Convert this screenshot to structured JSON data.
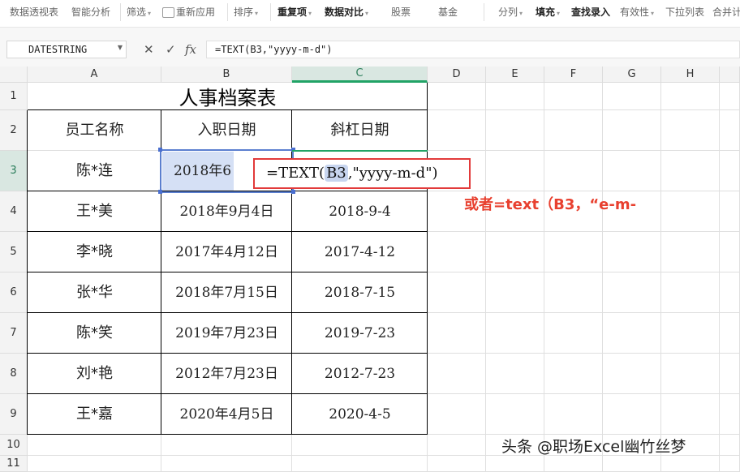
{
  "toolbar": {
    "items": [
      {
        "label": "数据透视表",
        "bold": false,
        "caret": false
      },
      {
        "label": "智能分析",
        "bold": false,
        "caret": false
      },
      {
        "label": "筛选",
        "bold": false,
        "caret": true
      },
      {
        "label": "重新应用",
        "bold": false,
        "caret": false
      },
      {
        "label": "排序",
        "bold": false,
        "caret": true
      },
      {
        "label": "重复项",
        "bold": true,
        "caret": true
      },
      {
        "label": "数据对比",
        "bold": true,
        "caret": true
      },
      {
        "label": "股票",
        "bold": false,
        "caret": false
      },
      {
        "label": "基金",
        "bold": false,
        "caret": false
      },
      {
        "label": "分列",
        "bold": false,
        "caret": true
      },
      {
        "label": "填充",
        "bold": true,
        "caret": true
      },
      {
        "label": "查找录入",
        "bold": true,
        "caret": false
      },
      {
        "label": "有效性",
        "bold": false,
        "caret": true
      },
      {
        "label": "下拉列表",
        "bold": false,
        "caret": false
      },
      {
        "label": "合并计",
        "bold": false,
        "caret": false
      }
    ]
  },
  "formula_bar": {
    "name_box": "DATESTRING",
    "cancel_icon": "✕",
    "confirm_icon": "✓",
    "fx_icon": "fx",
    "formula": "=TEXT(B3,\"yyyy-m-d\")"
  },
  "columns": [
    "A",
    "B",
    "C",
    "D",
    "E",
    "F",
    "G",
    "H"
  ],
  "rows": [
    "1",
    "2",
    "3",
    "4",
    "5",
    "6",
    "7",
    "8",
    "9",
    "10",
    "11"
  ],
  "sheet": {
    "title": "人事档案表",
    "headers": [
      "员工名称",
      "入职日期",
      "斜杠日期"
    ],
    "data": [
      {
        "name": "陈*连",
        "date": "2018年6",
        "slash": ""
      },
      {
        "name": "王*美",
        "date": "2018年9月4日",
        "slash": "2018-9-4"
      },
      {
        "name": "李*晓",
        "date": "2017年4月12日",
        "slash": "2017-4-12"
      },
      {
        "name": "张*华",
        "date": "2018年7月15日",
        "slash": "2018-7-15"
      },
      {
        "name": "陈*笑",
        "date": "2019年7月23日",
        "slash": "2019-7-23"
      },
      {
        "name": "刘*艳",
        "date": "2012年7月23日",
        "slash": "2012-7-23"
      },
      {
        "name": "王*嘉",
        "date": "2020年4月5日",
        "slash": "2020-4-5"
      }
    ]
  },
  "editing_popup": {
    "prefix": "=TEXT(",
    "ref": "B3",
    "suffix": ",\"yyyy-m-d\")"
  },
  "note": "或者=text（B3，“e-m-",
  "watermark": "头条 @职场Excel幽竹丝梦",
  "colors": {
    "accent_green": "#21a366",
    "ref_blue": "#5b7fcf",
    "note_red": "#e8402f"
  }
}
